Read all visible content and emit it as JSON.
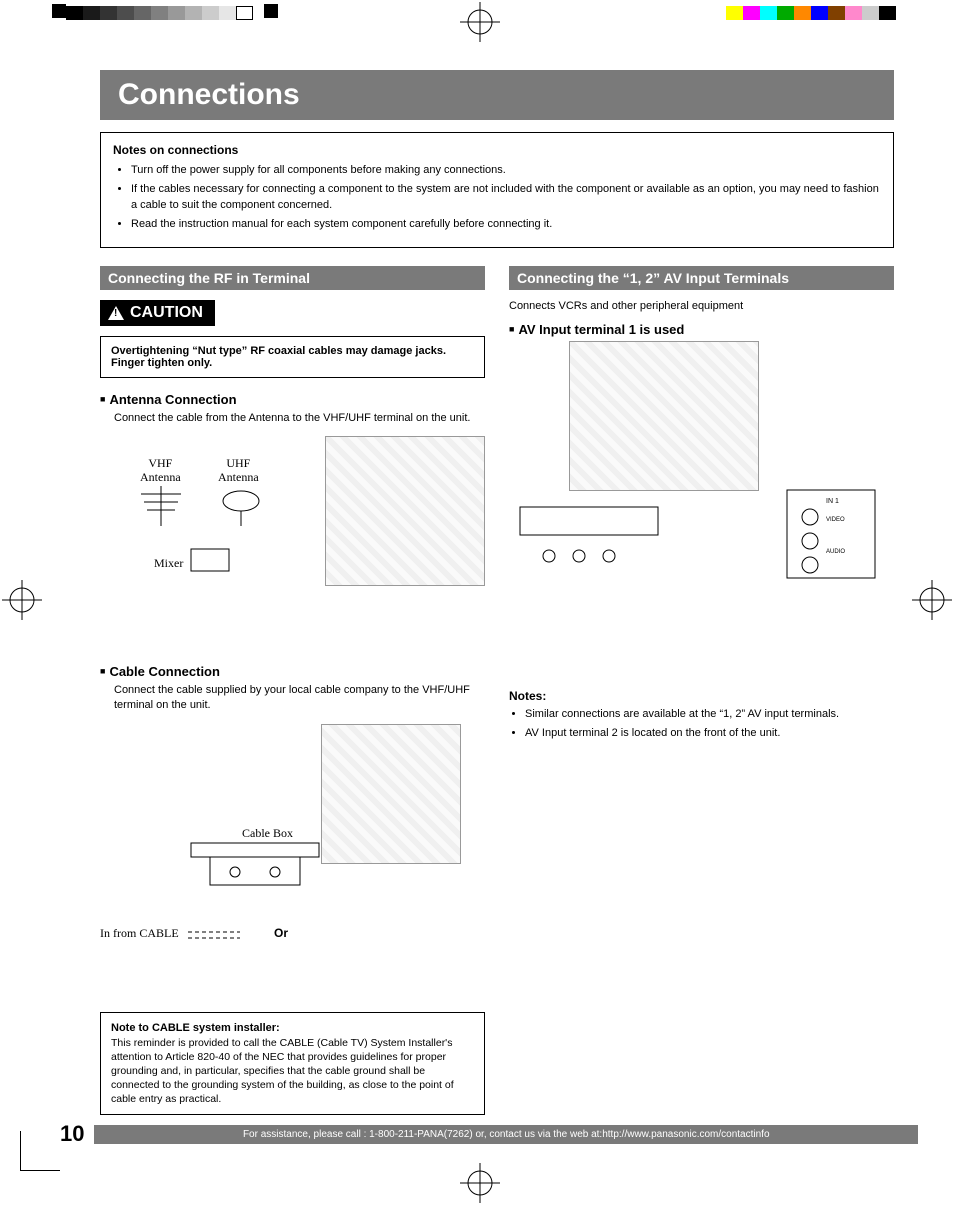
{
  "title": "Connections",
  "notesBox": {
    "title": "Notes on connections",
    "items": [
      "Turn off the power supply for all components before making any connections.",
      "If the cables necessary for connecting a component to the system are not included with the component or available as an option, you may need to fashion a cable to suit the component concerned.",
      "Read the instruction manual for each system component carefully before connecting it."
    ]
  },
  "left": {
    "sectionHeader": "Connecting the RF in Terminal",
    "cautionLabel": "CAUTION",
    "warning": "Overtightening “Nut type” RF coaxial cables may damage jacks. Finger tighten only.",
    "antenna": {
      "heading": "Antenna Connection",
      "desc": "Connect the cable from the Antenna to the VHF/UHF terminal on the unit.",
      "labels": {
        "vhf": "VHF\nAntenna",
        "uhf": "UHF\nAntenna",
        "mixer": "Mixer"
      }
    },
    "cable": {
      "heading": "Cable Connection",
      "desc": "Connect the cable supplied by your local cable company to the VHF/UHF terminal on the unit.",
      "labels": {
        "cableBox": "Cable Box",
        "inFromCable": "In from CABLE",
        "or": "Or"
      }
    },
    "installer": {
      "title": "Note to CABLE system installer:",
      "body": "This reminder is provided to call the CABLE (Cable TV) System Installer's attention to Article 820-40 of the NEC that provides guidelines for proper grounding and, in particular, specifies that the cable ground shall be connected to the grounding system of the building, as close to the point of cable entry as practical."
    }
  },
  "right": {
    "sectionHeader": "Connecting the “1, 2” AV Input Terminals",
    "intro": "Connects VCRs and other peripheral equipment",
    "avInputHeading": "AV Input terminal 1 is used",
    "notes": {
      "title": "Notes:",
      "items": [
        "Similar connections are available at the “1, 2” AV input terminals.",
        "AV Input terminal 2 is located on the front of the unit."
      ]
    }
  },
  "footer": {
    "pageNum": "10",
    "assist": "For assistance, please call : 1-800-211-PANA(7262) or, contact us via the web at:http://www.panasonic.com/contactinfo"
  }
}
